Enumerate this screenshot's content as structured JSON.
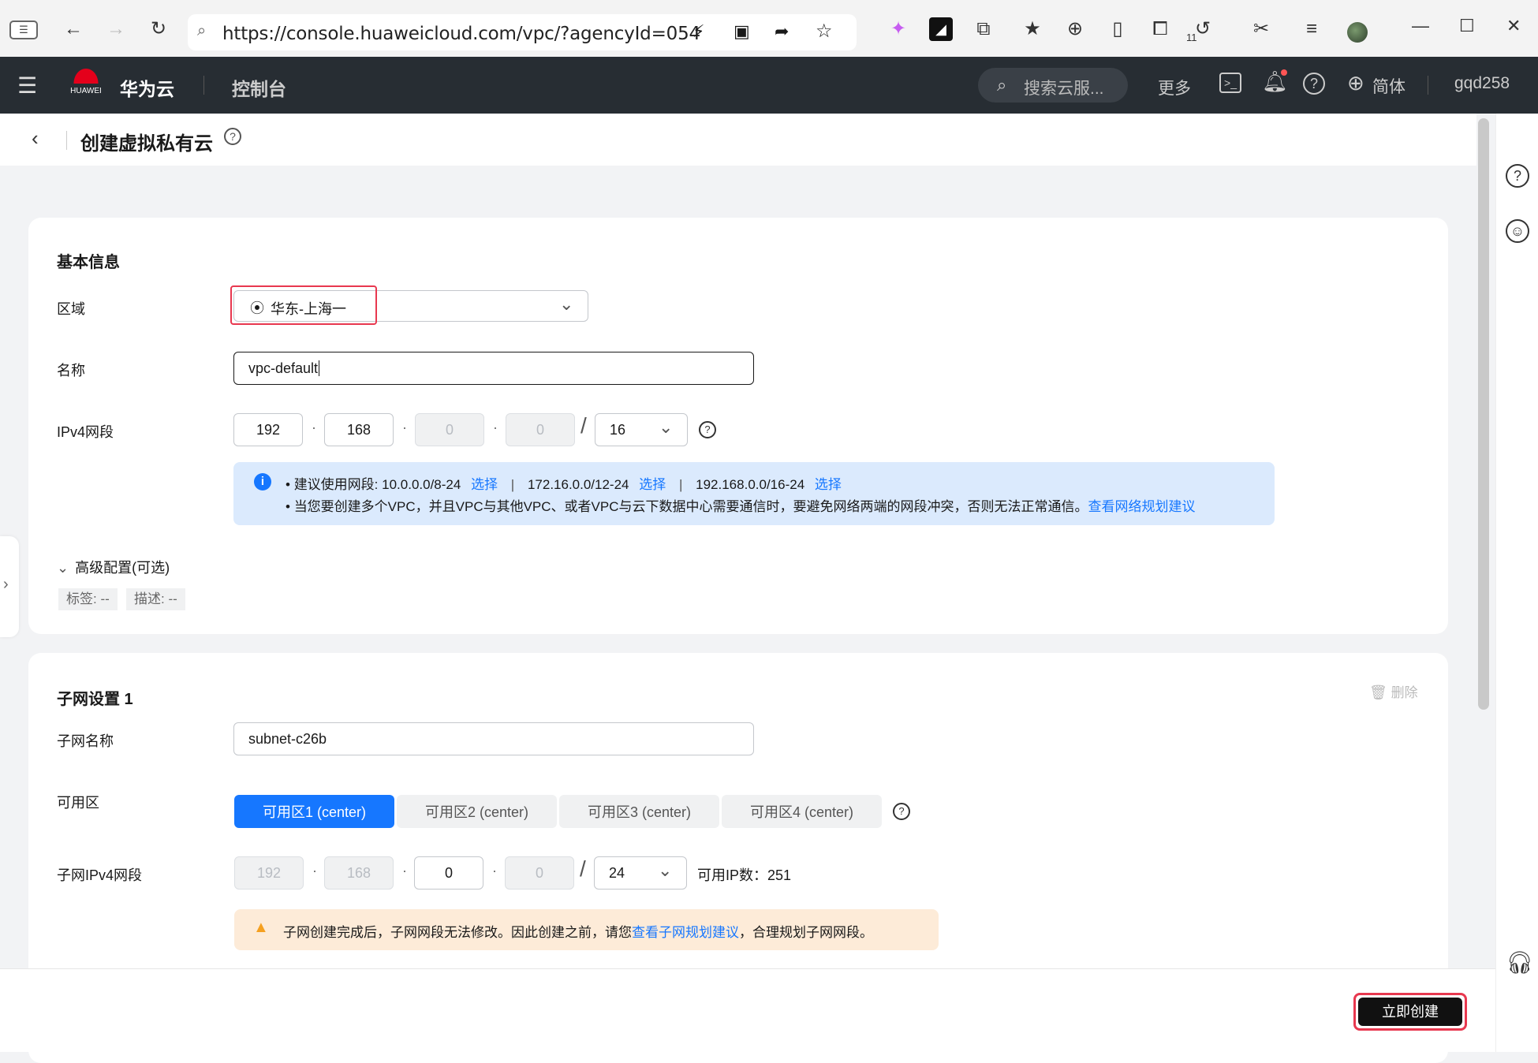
{
  "browser": {
    "url": "https://console.huaweicloud.com/vpc/?agencyId=054",
    "tab_count": "11"
  },
  "topnav": {
    "brand": "华为云",
    "brand_sub": "HUAWEI",
    "console": "控制台",
    "search_placeholder": "搜索云服...",
    "more": "更多",
    "lang": "简体",
    "user": "gqd258"
  },
  "page": {
    "title": "创建虚拟私有云"
  },
  "basic": {
    "section_title": "基本信息",
    "region_label": "区域",
    "region_value": "华东-上海一",
    "name_label": "名称",
    "name_value": "vpc-default",
    "ipv4_label": "IPv4网段",
    "ip": [
      "192",
      "168",
      "0",
      "0"
    ],
    "mask": "16",
    "tip_line1_prefix": "建议使用网段: 10.0.0.0/8-24",
    "tip_choose": "选择",
    "tip_seg2": "172.16.0.0/12-24",
    "tip_seg3": "192.168.0.0/16-24",
    "tip_line2": "当您要创建多个VPC，并且VPC与其他VPC、或者VPC与云下数据中心需要通信时，要避免网络两端的网段冲突，否则无法正常通信。",
    "tip_line2_link": "查看网络规划建议",
    "advanced_label": "高级配置(可选)",
    "tag_label": "标签: --",
    "desc_label": "描述: --"
  },
  "subnet": {
    "section_title": "子网设置 1",
    "delete_label": "删除",
    "name_label": "子网名称",
    "name_value": "subnet-c26b",
    "az_label": "可用区",
    "az_options": [
      "可用区1 (center)",
      "可用区2 (center)",
      "可用区3 (center)",
      "可用区4 (center)"
    ],
    "ipv4_label": "子网IPv4网段",
    "ip": [
      "192",
      "168",
      "0",
      "0"
    ],
    "mask": "24",
    "available_ip": "可用IP数：251",
    "warn_prefix": "子网创建完成后，子网网段无法修改。因此创建之前，请您",
    "warn_link": "查看子网规划建议",
    "warn_suffix": "，合理规划子网网段。"
  },
  "footer": {
    "create_button": "立即创建"
  }
}
